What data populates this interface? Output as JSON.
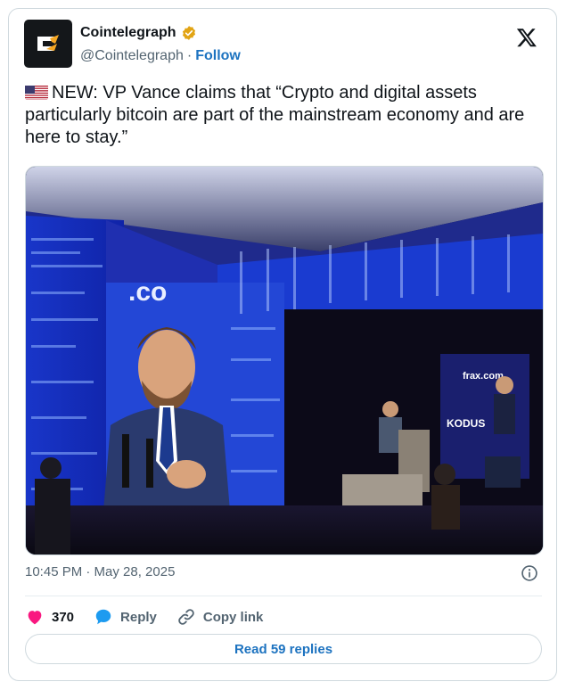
{
  "account": {
    "name": "Cointelegraph",
    "handle": "@Cointelegraph",
    "separator": "·",
    "follow_label": "Follow",
    "avatar_icon": "cointelegraph-logo",
    "verified_color": "#e2a414"
  },
  "tweet": {
    "flag_icon": "us-flag",
    "text": "NEW: VP Vance claims that “Crypto and digital assets particularly bitcoin are part of the mainstream economy and are here to stay.”",
    "media_icon": "photo-vance-on-stage",
    "timestamp": "10:45 PM · May 28, 2025"
  },
  "actions": {
    "like_count": "370",
    "reply_label": "Reply",
    "copy_link_label": "Copy link",
    "like_color": "#f91880",
    "reply_color": "#1d9bf0"
  },
  "read_replies_label": "Read 59 replies",
  "colors": {
    "link": "#1d73c0",
    "secondary_text": "#536471",
    "border": "#cfd9de"
  }
}
